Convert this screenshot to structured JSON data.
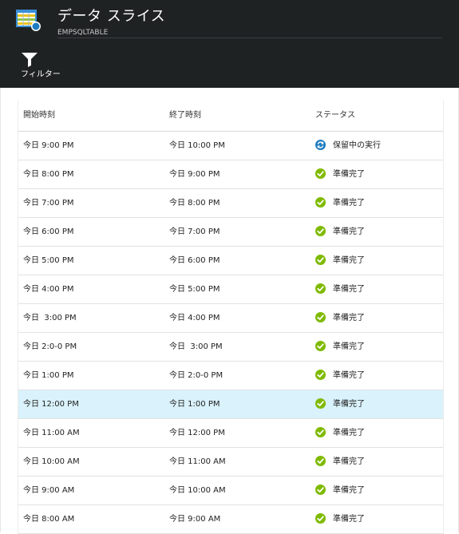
{
  "header": {
    "title": "データ スライス",
    "subtitle": "EMPSQLTABLE",
    "filter_label": "フィルター"
  },
  "colors": {
    "header_bg": "#1f2223",
    "ready_green": "#7fba00",
    "inprogress_blue": "#1e7bbf",
    "selected_row": "#d9f2fb"
  },
  "table": {
    "headers": [
      "開始時刻",
      "終了時刻",
      "ステータス"
    ],
    "rows": [
      {
        "start": "今日 9:00 PM",
        "end": "今日 10:00 PM",
        "status": "保留中の実行",
        "status_type": "in-progress"
      },
      {
        "start": "今日 8:00 PM",
        "end": "今日 9:00 PM",
        "status": "準備完了",
        "status_type": "ready"
      },
      {
        "start": "今日 7:00 PM",
        "end": "今日 8:00 PM",
        "status": "準備完了",
        "status_type": "ready"
      },
      {
        "start": "今日 6:00 PM",
        "end": "今日 7:00 PM",
        "status": "準備完了",
        "status_type": "ready"
      },
      {
        "start": "今日 5:00 PM",
        "end": "今日 6:00 PM",
        "status": "準備完了",
        "status_type": "ready"
      },
      {
        "start": "今日 4:00 PM",
        "end": "今日 5:00 PM",
        "status": "準備完了",
        "status_type": "ready"
      },
      {
        "start": "今日  3:00 PM",
        "end": "今日 4:00 PM",
        "status": "準備完了",
        "status_type": "ready"
      },
      {
        "start": "今日 2:0-0 PM",
        "end": "今日  3:00 PM",
        "status": "準備完了",
        "status_type": "ready"
      },
      {
        "start": "今日 1:00 PM",
        "end": "今日 2:0-0 PM",
        "status": "準備完了",
        "status_type": "ready"
      },
      {
        "start": "今日 12:00 PM",
        "end": "今日 1:00 PM",
        "status": "準備完了",
        "status_type": "ready",
        "selected": true
      },
      {
        "start": "今日 11:00 AM",
        "end": "今日 12:00 PM",
        "status": "準備完了",
        "status_type": "ready"
      },
      {
        "start": "今日 10:00 AM",
        "end": "今日 11:00 AM",
        "status": "準備完了",
        "status_type": "ready"
      },
      {
        "start": "今日 9:00 AM",
        "end": "今日 10:00 AM",
        "status": "準備完了",
        "status_type": "ready"
      },
      {
        "start": "今日 8:00 AM",
        "end": "今日 9:00 AM",
        "status": "準備完了",
        "status_type": "ready"
      }
    ]
  }
}
